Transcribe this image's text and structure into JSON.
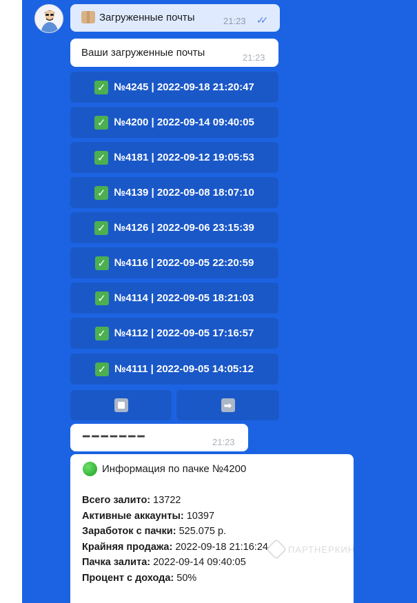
{
  "colors": {
    "chat_background": "#1c63e3",
    "inline_button": "#1a58c8",
    "outgoing_bubble": "#dfeaff",
    "incoming_bubble": "#ffffff",
    "check_green": "#4caf50"
  },
  "outgoing_message": {
    "icon": "package-icon",
    "text": "Загруженные почты",
    "time": "21:23",
    "status_icon": "double-check-icon"
  },
  "bot_message_1": {
    "text": "Ваши загруженные почты",
    "time": "21:23"
  },
  "batch_buttons": [
    {
      "check": "✓",
      "label": "№4245 | 2022-09-18 21:20:47"
    },
    {
      "check": "✓",
      "label": "№4200 | 2022-09-14 09:40:05"
    },
    {
      "check": "✓",
      "label": "№4181 | 2022-09-12 19:05:53"
    },
    {
      "check": "✓",
      "label": "№4139 | 2022-09-08 18:07:10"
    },
    {
      "check": "✓",
      "label": "№4126 | 2022-09-06 23:15:39"
    },
    {
      "check": "✓",
      "label": "№4116 | 2022-09-05 22:20:59"
    },
    {
      "check": "✓",
      "label": "№4114 | 2022-09-05 18:21:03"
    },
    {
      "check": "✓",
      "label": "№4112 | 2022-09-05 17:16:57"
    },
    {
      "check": "✓",
      "label": "№4111 | 2022-09-05 14:05:12"
    }
  ],
  "nav_buttons": {
    "stop_icon": "stop-icon",
    "next_icon": "right-arrow-icon",
    "next_glyph": "➡"
  },
  "bot_message_2": {
    "text": "━━━━━━━",
    "time": "21:23"
  },
  "info_message": {
    "heading": "Информация по пачке №4200",
    "lines": [
      {
        "label": "Всего залито:",
        "value": " 13722"
      },
      {
        "label": "Активные аккаунты:",
        "value": " 10397"
      },
      {
        "label": "Заработок с пачки:",
        "value": " 525.075 р."
      },
      {
        "label": "Крайняя продажа:",
        "value": " 2022-09-18 21:16:24"
      },
      {
        "label": "Пачка залита:",
        "value": " 2022-09-14 09:40:05"
      },
      {
        "label": "Процент с дохода:",
        "value": " 50%"
      }
    ]
  },
  "watermark": {
    "text": "ПАРТНЕРКИН"
  }
}
